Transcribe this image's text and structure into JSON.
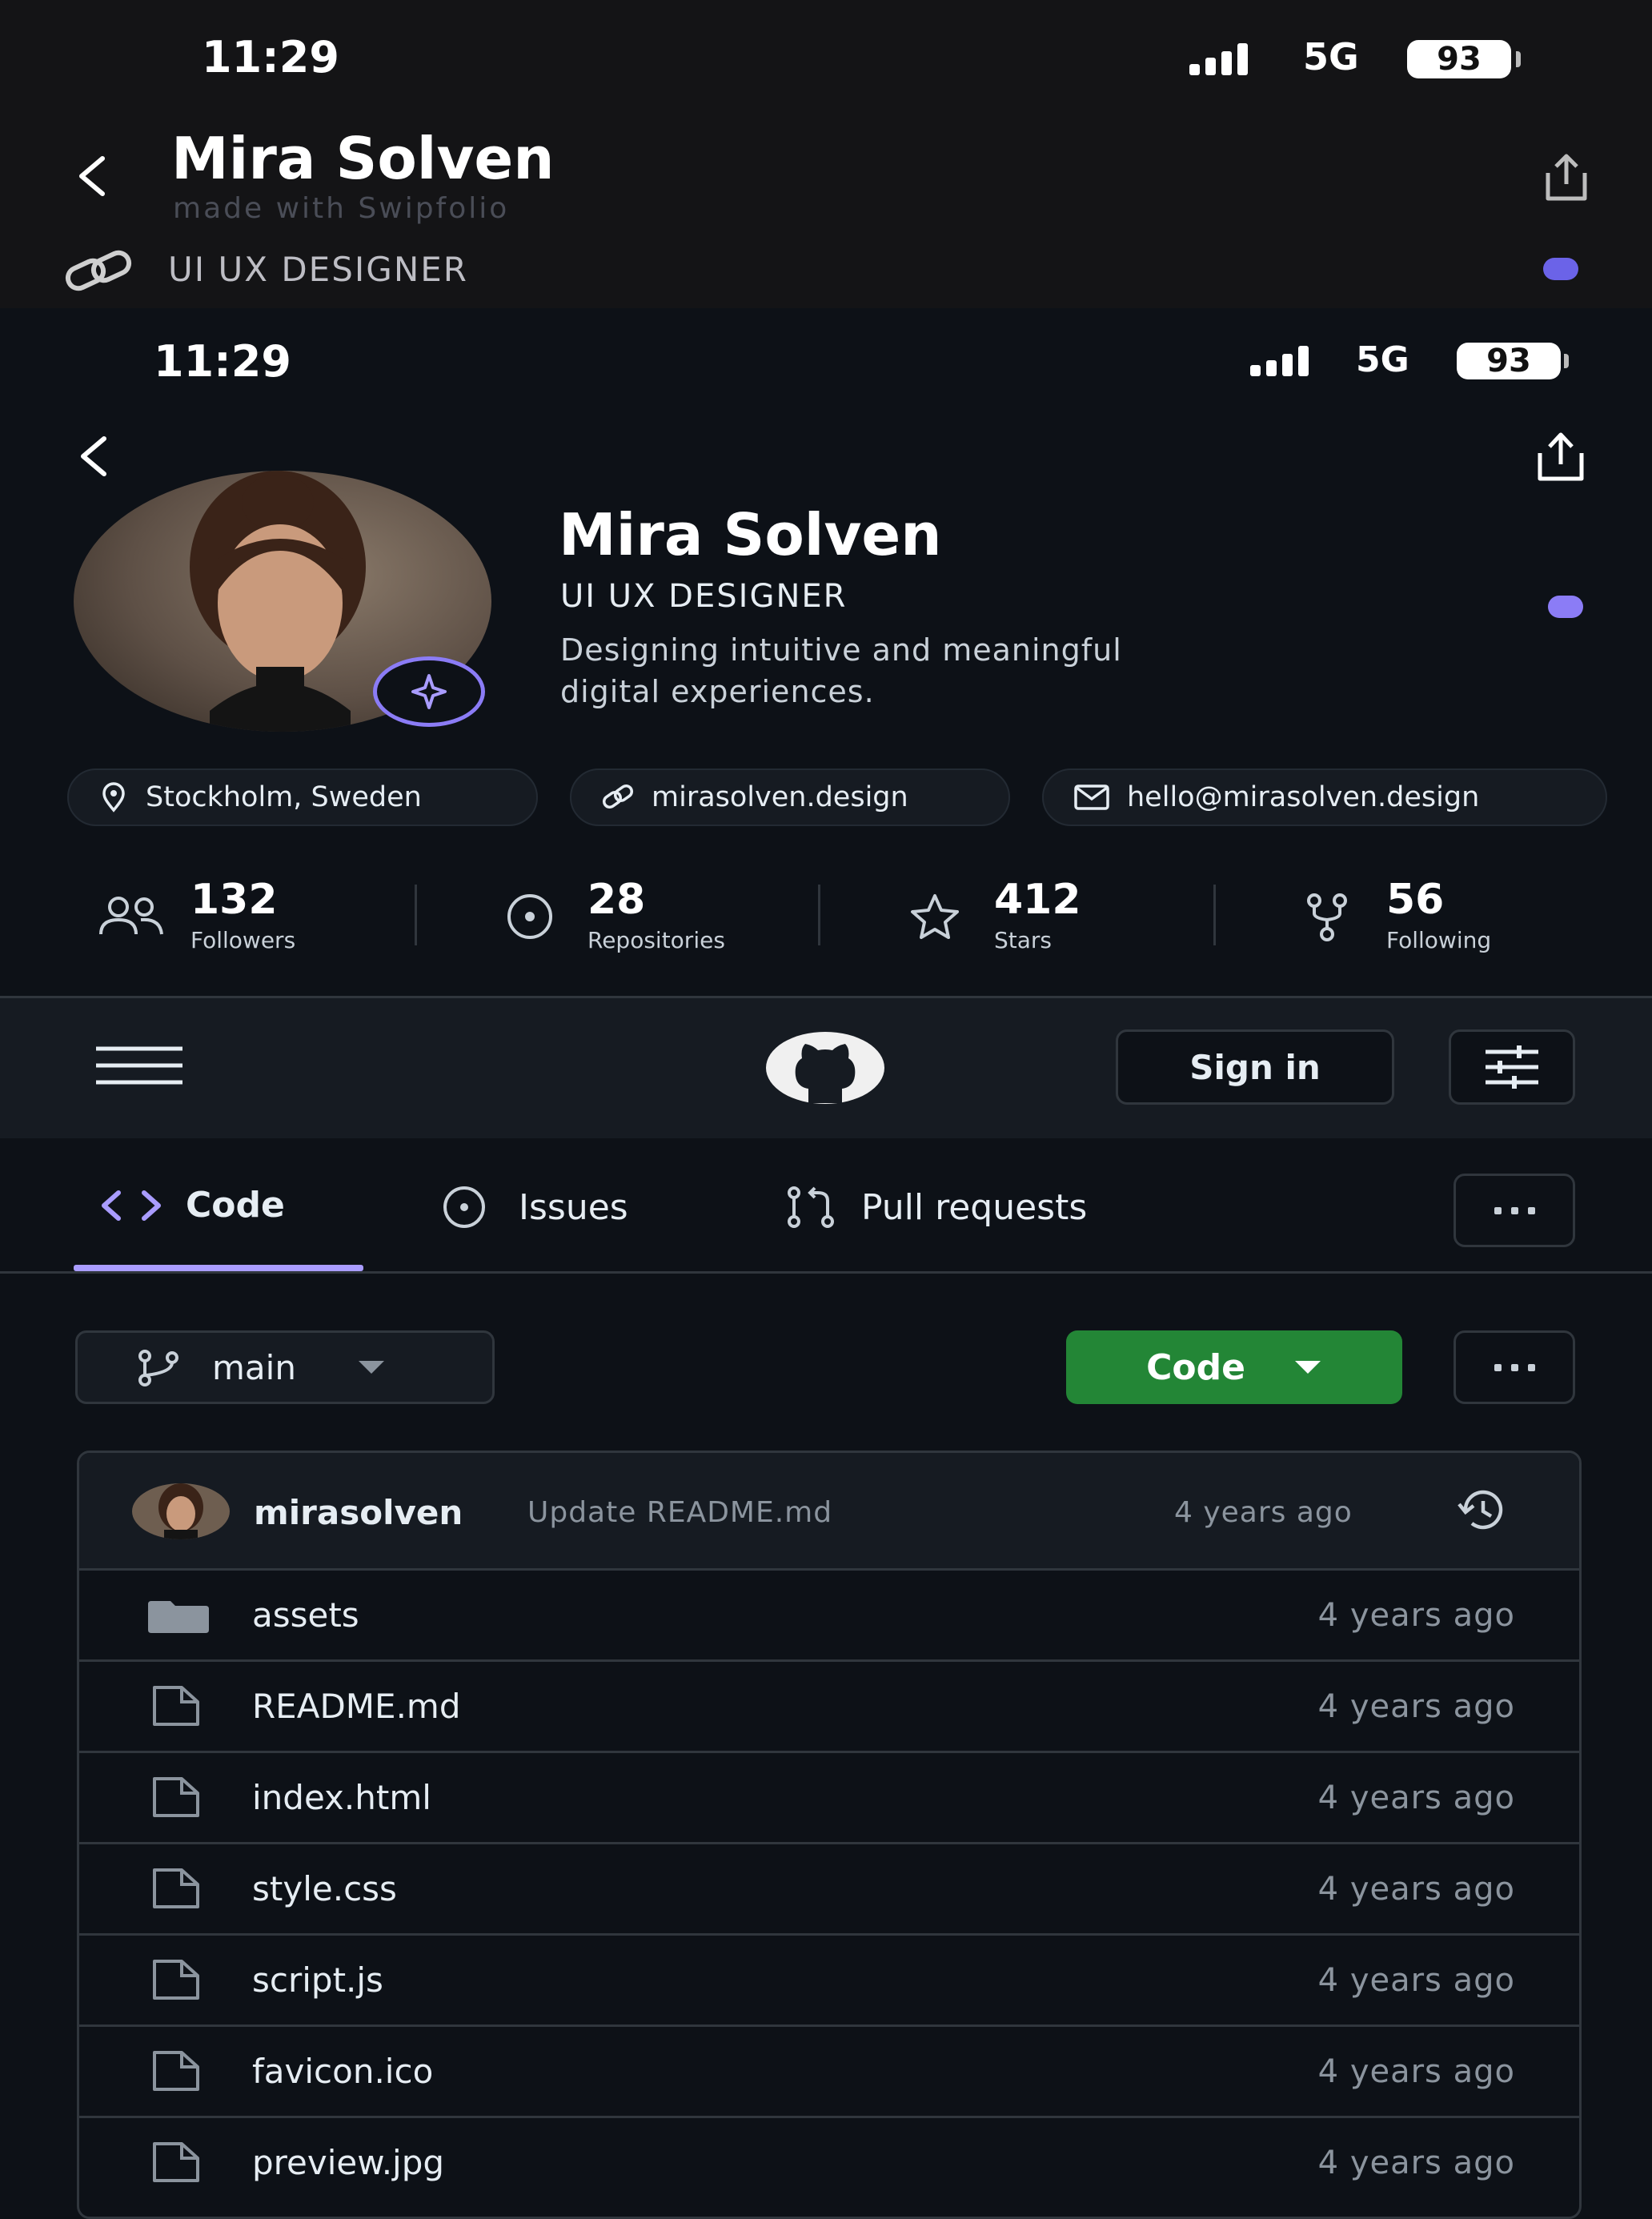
{
  "outer": {
    "time": "11:29",
    "network": "5G",
    "battery": "93",
    "title": "Mira Solven",
    "subtitle": "made with Swipfolio",
    "role": "UI UX DESIGNER"
  },
  "inner_status": {
    "time": "11:29",
    "network": "5G",
    "battery": "93"
  },
  "profile": {
    "name": "Mira Solven",
    "role": "UI UX DESIGNER",
    "bio_line1": "Designing intuitive and meaningful",
    "bio_line2": "digital experiences.",
    "location": "Stockholm, Sweden",
    "website": "mirasolven.design",
    "email": "hello@mirasolven.design"
  },
  "stats": [
    {
      "value": "132",
      "label": "Followers",
      "icon": "people-icon"
    },
    {
      "value": "28",
      "label": "Repositories",
      "icon": "repo-circle-icon"
    },
    {
      "value": "412",
      "label": "Stars",
      "icon": "star-icon"
    },
    {
      "value": "56",
      "label": "Following",
      "icon": "fork-icon"
    }
  ],
  "navbar": {
    "sign_in": "Sign in"
  },
  "tabs": [
    {
      "label": "Code",
      "active": true
    },
    {
      "label": "Issues",
      "active": false
    },
    {
      "label": "Pull requests",
      "active": false
    }
  ],
  "repo": {
    "branch": "main",
    "code_button": "Code",
    "commit": {
      "author": "mirasolven",
      "message": "Update README.md",
      "time": "4 years ago"
    },
    "files": [
      {
        "name": "assets",
        "type": "folder",
        "time": "4 years ago"
      },
      {
        "name": "README.md",
        "type": "file",
        "time": "4 years ago"
      },
      {
        "name": "index.html",
        "type": "file",
        "time": "4 years ago"
      },
      {
        "name": "style.css",
        "type": "file",
        "time": "4 years ago"
      },
      {
        "name": "script.js",
        "type": "file",
        "time": "4 years ago"
      },
      {
        "name": "favicon.ico",
        "type": "file",
        "time": "4 years ago"
      },
      {
        "name": "preview.jpg",
        "type": "file",
        "time": "4 years ago"
      }
    ]
  },
  "colors": {
    "accent_purple": "#8b7cf6",
    "green_button": "#238636",
    "background": "#0d1117"
  }
}
